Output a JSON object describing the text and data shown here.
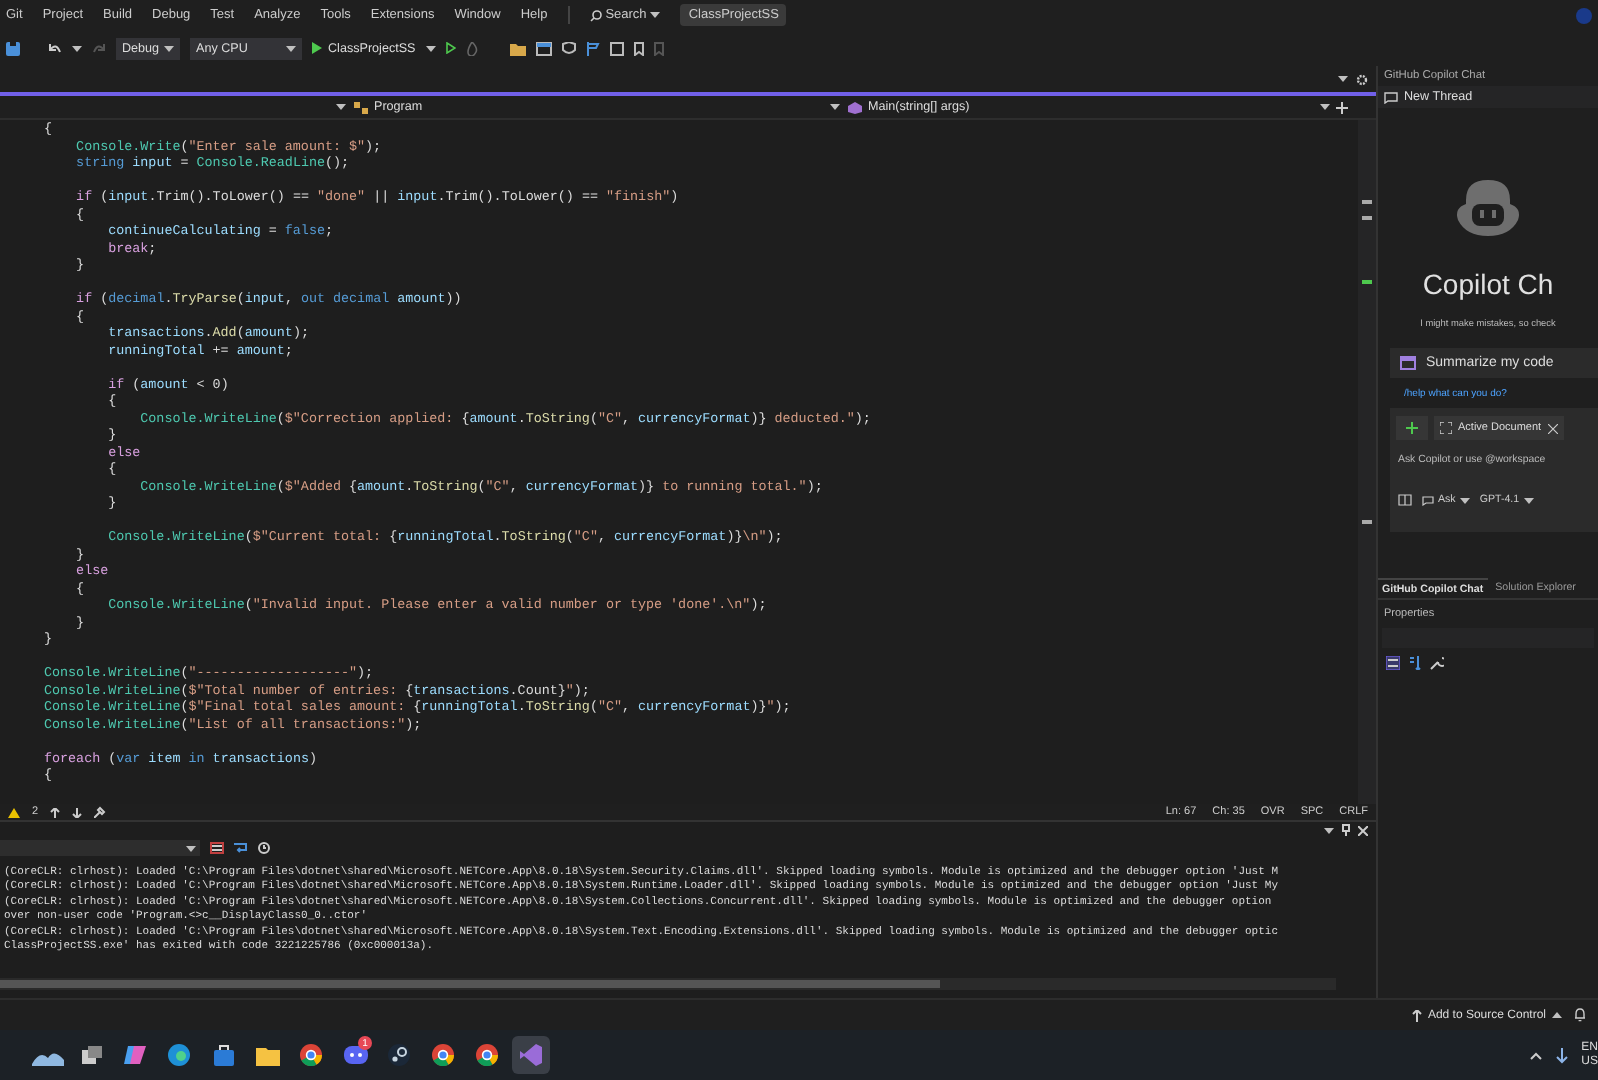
{
  "menu": [
    "Git",
    "Project",
    "Build",
    "Debug",
    "Test",
    "Analyze",
    "Tools",
    "Extensions",
    "Window",
    "Help"
  ],
  "search": {
    "label": "Search"
  },
  "solution_name": "ClassProjectSS",
  "toolbar": {
    "configuration": "Debug",
    "platform": "Any CPU",
    "start_target": "ClassProjectSS"
  },
  "nav": {
    "type": "Program",
    "member": "Main(string[] args)"
  },
  "code_lines": [
    {
      "kind": "code",
      "segs": [
        {
          "kind": "plain",
          "text": "{"
        }
      ]
    },
    {
      "kind": "code",
      "segs": [
        {
          "kind": "class",
          "text": "    Console.Write"
        },
        {
          "kind": "plain",
          "text": "("
        },
        {
          "kind": "string",
          "text": "\"Enter sale amount: $\""
        },
        {
          "kind": "plain",
          "text": ");"
        }
      ]
    },
    {
      "kind": "code",
      "segs": [
        {
          "kind": "keyword",
          "text": "    string"
        },
        {
          "kind": "variable",
          "text": " input"
        },
        {
          "kind": "plain",
          "text": " = "
        },
        {
          "kind": "class",
          "text": "Console.ReadLine"
        },
        {
          "kind": "plain",
          "text": "();"
        }
      ]
    },
    {
      "kind": "blank"
    },
    {
      "kind": "code",
      "segs": [
        {
          "kind": "control",
          "text": "    if"
        },
        {
          "kind": "plain",
          "text": " ("
        },
        {
          "kind": "variable",
          "text": "input"
        },
        {
          "kind": "plain",
          "text": ".Trim().ToLower() == "
        },
        {
          "kind": "string",
          "text": "\"done\""
        },
        {
          "kind": "plain",
          "text": " || "
        },
        {
          "kind": "variable",
          "text": "input"
        },
        {
          "kind": "plain",
          "text": ".Trim().ToLower() == "
        },
        {
          "kind": "string",
          "text": "\"finish\""
        },
        {
          "kind": "plain",
          "text": ")"
        }
      ]
    },
    {
      "kind": "code",
      "segs": [
        {
          "kind": "plain",
          "text": "    {"
        }
      ]
    },
    {
      "kind": "code",
      "segs": [
        {
          "kind": "variable",
          "text": "        continueCalculating"
        },
        {
          "kind": "plain",
          "text": " = "
        },
        {
          "kind": "keyword",
          "text": "false"
        },
        {
          "kind": "plain",
          "text": ";"
        }
      ]
    },
    {
      "kind": "code",
      "segs": [
        {
          "kind": "control",
          "text": "        break"
        },
        {
          "kind": "plain",
          "text": ";"
        }
      ]
    },
    {
      "kind": "code",
      "segs": [
        {
          "kind": "plain",
          "text": "    }"
        }
      ]
    },
    {
      "kind": "blank"
    },
    {
      "kind": "code",
      "segs": [
        {
          "kind": "control",
          "text": "    if"
        },
        {
          "kind": "plain",
          "text": " ("
        },
        {
          "kind": "keyword",
          "text": "decimal"
        },
        {
          "kind": "plain",
          "text": "."
        },
        {
          "kind": "method",
          "text": "TryParse"
        },
        {
          "kind": "plain",
          "text": "("
        },
        {
          "kind": "variable",
          "text": "input"
        },
        {
          "kind": "plain",
          "text": ", "
        },
        {
          "kind": "keyword",
          "text": "out decimal"
        },
        {
          "kind": "variable",
          "text": " amount"
        },
        {
          "kind": "plain",
          "text": "))"
        }
      ]
    },
    {
      "kind": "code",
      "segs": [
        {
          "kind": "plain",
          "text": "    {"
        }
      ]
    },
    {
      "kind": "code",
      "segs": [
        {
          "kind": "variable",
          "text": "        transactions"
        },
        {
          "kind": "plain",
          "text": "."
        },
        {
          "kind": "method",
          "text": "Add"
        },
        {
          "kind": "plain",
          "text": "("
        },
        {
          "kind": "variable",
          "text": "amount"
        },
        {
          "kind": "plain",
          "text": ");"
        }
      ]
    },
    {
      "kind": "code",
      "segs": [
        {
          "kind": "variable",
          "text": "        runningTotal"
        },
        {
          "kind": "plain",
          "text": " += "
        },
        {
          "kind": "variable",
          "text": "amount"
        },
        {
          "kind": "plain",
          "text": ";"
        }
      ]
    },
    {
      "kind": "blank"
    },
    {
      "kind": "code",
      "segs": [
        {
          "kind": "control",
          "text": "        if"
        },
        {
          "kind": "plain",
          "text": " ("
        },
        {
          "kind": "variable",
          "text": "amount"
        },
        {
          "kind": "plain",
          "text": " < 0)"
        }
      ]
    },
    {
      "kind": "code",
      "segs": [
        {
          "kind": "plain",
          "text": "        {"
        }
      ]
    },
    {
      "kind": "code",
      "segs": [
        {
          "kind": "class",
          "text": "            Console.WriteLine"
        },
        {
          "kind": "plain",
          "text": "("
        },
        {
          "kind": "string",
          "text": "$\"Correction applied: "
        },
        {
          "kind": "plain",
          "text": "{"
        },
        {
          "kind": "variable",
          "text": "amount"
        },
        {
          "kind": "plain",
          "text": "."
        },
        {
          "kind": "method",
          "text": "ToString"
        },
        {
          "kind": "plain",
          "text": "("
        },
        {
          "kind": "string",
          "text": "\"C\""
        },
        {
          "kind": "plain",
          "text": ", "
        },
        {
          "kind": "variable",
          "text": "currencyFormat"
        },
        {
          "kind": "plain",
          "text": ")}"
        },
        {
          "kind": "string",
          "text": " deducted.\""
        },
        {
          "kind": "plain",
          "text": ");"
        }
      ]
    },
    {
      "kind": "code",
      "segs": [
        {
          "kind": "plain",
          "text": "        }"
        }
      ]
    },
    {
      "kind": "code",
      "segs": [
        {
          "kind": "control",
          "text": "        else"
        }
      ]
    },
    {
      "kind": "code",
      "segs": [
        {
          "kind": "plain",
          "text": "        {"
        }
      ]
    },
    {
      "kind": "code",
      "segs": [
        {
          "kind": "class",
          "text": "            Console.WriteLine"
        },
        {
          "kind": "plain",
          "text": "("
        },
        {
          "kind": "string",
          "text": "$\"Added "
        },
        {
          "kind": "plain",
          "text": "{"
        },
        {
          "kind": "variable",
          "text": "amount"
        },
        {
          "kind": "plain",
          "text": "."
        },
        {
          "kind": "method",
          "text": "ToString"
        },
        {
          "kind": "plain",
          "text": "("
        },
        {
          "kind": "string",
          "text": "\"C\""
        },
        {
          "kind": "plain",
          "text": ", "
        },
        {
          "kind": "variable",
          "text": "currencyFormat"
        },
        {
          "kind": "plain",
          "text": ")}"
        },
        {
          "kind": "string",
          "text": " to running total.\""
        },
        {
          "kind": "plain",
          "text": ");"
        }
      ]
    },
    {
      "kind": "code",
      "segs": [
        {
          "kind": "plain",
          "text": "        }"
        }
      ]
    },
    {
      "kind": "blank"
    },
    {
      "kind": "code",
      "segs": [
        {
          "kind": "class",
          "text": "        Console.WriteLine"
        },
        {
          "kind": "plain",
          "text": "("
        },
        {
          "kind": "string",
          "text": "$\"Current total: "
        },
        {
          "kind": "plain",
          "text": "{"
        },
        {
          "kind": "variable",
          "text": "runningTotal"
        },
        {
          "kind": "plain",
          "text": "."
        },
        {
          "kind": "method",
          "text": "ToString"
        },
        {
          "kind": "plain",
          "text": "("
        },
        {
          "kind": "string",
          "text": "\"C\""
        },
        {
          "kind": "plain",
          "text": ", "
        },
        {
          "kind": "variable",
          "text": "currencyFormat"
        },
        {
          "kind": "plain",
          "text": ")}"
        },
        {
          "kind": "string",
          "text": "\\n\""
        },
        {
          "kind": "plain",
          "text": ");"
        }
      ]
    },
    {
      "kind": "code",
      "segs": [
        {
          "kind": "plain",
          "text": "    }"
        }
      ]
    },
    {
      "kind": "code",
      "segs": [
        {
          "kind": "control",
          "text": "    else"
        }
      ]
    },
    {
      "kind": "code",
      "segs": [
        {
          "kind": "plain",
          "text": "    {"
        }
      ]
    },
    {
      "kind": "code",
      "segs": [
        {
          "kind": "class",
          "text": "        Console.WriteLine"
        },
        {
          "kind": "plain",
          "text": "("
        },
        {
          "kind": "string",
          "text": "\"Invalid input. Please enter a valid number or type 'done'.\\n\""
        },
        {
          "kind": "plain",
          "text": ");"
        }
      ]
    },
    {
      "kind": "code",
      "segs": [
        {
          "kind": "plain",
          "text": "    }"
        }
      ]
    },
    {
      "kind": "code",
      "segs": [
        {
          "kind": "plain",
          "text": "}"
        }
      ]
    },
    {
      "kind": "blank"
    },
    {
      "kind": "code",
      "segs": [
        {
          "kind": "class",
          "text": "Console.WriteLine"
        },
        {
          "kind": "plain",
          "text": "("
        },
        {
          "kind": "string",
          "text": "\"-------------------\""
        },
        {
          "kind": "plain",
          "text": ");"
        }
      ]
    },
    {
      "kind": "code",
      "segs": [
        {
          "kind": "class",
          "text": "Console.WriteLine"
        },
        {
          "kind": "plain",
          "text": "("
        },
        {
          "kind": "string",
          "text": "$\"Total number of entries: "
        },
        {
          "kind": "plain",
          "text": "{"
        },
        {
          "kind": "variable",
          "text": "transactions"
        },
        {
          "kind": "plain",
          "text": ".Count}"
        },
        {
          "kind": "string",
          "text": "\""
        },
        {
          "kind": "plain",
          "text": ");"
        }
      ]
    },
    {
      "kind": "code",
      "segs": [
        {
          "kind": "class",
          "text": "Console.WriteLine"
        },
        {
          "kind": "plain",
          "text": "("
        },
        {
          "kind": "string",
          "text": "$\"Final total sales amount: "
        },
        {
          "kind": "plain",
          "text": "{"
        },
        {
          "kind": "variable",
          "text": "runningTotal"
        },
        {
          "kind": "plain",
          "text": "."
        },
        {
          "kind": "method",
          "text": "ToString"
        },
        {
          "kind": "plain",
          "text": "("
        },
        {
          "kind": "string",
          "text": "\"C\""
        },
        {
          "kind": "plain",
          "text": ", "
        },
        {
          "kind": "variable",
          "text": "currencyFormat"
        },
        {
          "kind": "plain",
          "text": ")}"
        },
        {
          "kind": "string",
          "text": "\""
        },
        {
          "kind": "plain",
          "text": ");"
        }
      ]
    },
    {
      "kind": "code",
      "segs": [
        {
          "kind": "class",
          "text": "Console.WriteLine"
        },
        {
          "kind": "plain",
          "text": "("
        },
        {
          "kind": "string",
          "text": "\"List of all transactions:\""
        },
        {
          "kind": "plain",
          "text": ");"
        }
      ]
    },
    {
      "kind": "blank"
    },
    {
      "kind": "code",
      "segs": [
        {
          "kind": "control",
          "text": "foreach"
        },
        {
          "kind": "plain",
          "text": " ("
        },
        {
          "kind": "keyword",
          "text": "var"
        },
        {
          "kind": "variable",
          "text": " item"
        },
        {
          "kind": "keyword",
          "text": " in"
        },
        {
          "kind": "variable",
          "text": " transactions"
        },
        {
          "kind": "plain",
          "text": ")"
        }
      ]
    },
    {
      "kind": "code",
      "segs": [
        {
          "kind": "plain",
          "text": "{"
        }
      ]
    }
  ],
  "editor_status": {
    "warnings": "2",
    "line": "Ln: 67",
    "column": "Ch: 35",
    "mode": "OVR",
    "indent": "SPC",
    "line_ending": "CRLF"
  },
  "output_lines": [
    "(CoreCLR: clrhost): Loaded 'C:\\Program Files\\dotnet\\shared\\Microsoft.NETCore.App\\8.0.18\\System.Security.Claims.dll'. Skipped loading symbols. Module is optimized and the debugger option 'Just M",
    "(CoreCLR: clrhost): Loaded 'C:\\Program Files\\dotnet\\shared\\Microsoft.NETCore.App\\8.0.18\\System.Runtime.Loader.dll'. Skipped loading symbols. Module is optimized and the debugger option 'Just My",
    "(CoreCLR: clrhost): Loaded 'C:\\Program Files\\dotnet\\shared\\Microsoft.NETCore.App\\8.0.18\\System.Collections.Concurrent.dll'. Skipped loading symbols. Module is optimized and the debugger option",
    "over non-user code 'Program.<>c__DisplayClass0_0..ctor'",
    "(CoreCLR: clrhost): Loaded 'C:\\Program Files\\dotnet\\shared\\Microsoft.NETCore.App\\8.0.18\\System.Text.Encoding.Extensions.dll'. Skipped loading symbols. Module is optimized and the debugger optic",
    "ClassProjectSS.exe' has exited with code 3221225786 (0xc000013a)."
  ],
  "copilot": {
    "panel_title": "GitHub Copilot Chat",
    "new_thread": "New Thread",
    "heading": "Copilot Ch",
    "disclaimer": "I might make mistakes, so check",
    "suggestion": "Summarize my code",
    "help_link": "/help what can you do?",
    "context_chip": "Active Document",
    "placeholder": "Ask Copilot or use @workspace",
    "mode": "Ask",
    "model": "GPT-4.1",
    "tabs": [
      {
        "label": "GitHub Copilot Chat",
        "selected": true
      },
      {
        "label": "Solution Explorer",
        "selected": false
      }
    ],
    "properties_title": "Properties"
  },
  "status_bar": {
    "source_control": "Add to Source Control"
  },
  "taskbar": {
    "apps": [
      {
        "kind": "widgets",
        "selected": false
      },
      {
        "kind": "taskview",
        "selected": false
      },
      {
        "kind": "copilot",
        "selected": false
      },
      {
        "kind": "edge",
        "selected": false
      },
      {
        "kind": "store",
        "selected": false
      },
      {
        "kind": "explorer",
        "selected": false
      },
      {
        "kind": "chrome",
        "selected": false
      },
      {
        "kind": "chat",
        "selected": false,
        "badge": "1"
      },
      {
        "kind": "steam",
        "selected": false
      },
      {
        "kind": "chrome",
        "selected": false
      },
      {
        "kind": "chrome",
        "selected": false
      },
      {
        "kind": "vs",
        "selected": true
      }
    ],
    "language": "EN",
    "region": "US"
  }
}
